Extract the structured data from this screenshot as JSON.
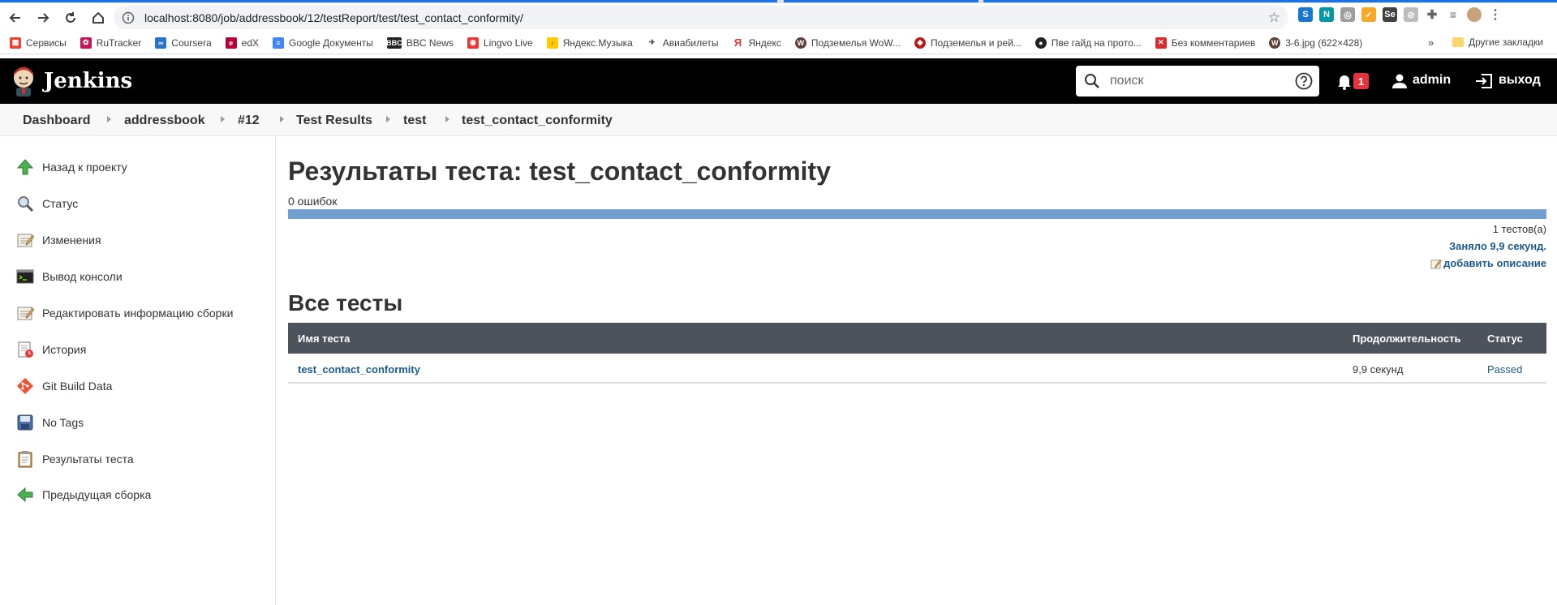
{
  "browser": {
    "url": "localhost:8080/job/addressbook/12/testReport/test/test_contact_conformity/",
    "bookmarks": [
      {
        "label": "Сервисы",
        "color": "#4285f4"
      },
      {
        "label": "RuTracker",
        "color": "#c2185b"
      },
      {
        "label": "Coursera",
        "color": "#2a73cc"
      },
      {
        "label": "edX",
        "color": "#b3003b"
      },
      {
        "label": "Google Документы",
        "color": "#4285f4"
      },
      {
        "label": "BBC News",
        "color": "#222222"
      },
      {
        "label": "Lingvo Live",
        "color": "#e53935"
      },
      {
        "label": "Яндекс.Музыка",
        "color": "#ffcc00"
      },
      {
        "label": "Авиабилеты",
        "color": "#333333"
      },
      {
        "label": "Яндекс",
        "color": "#e53935"
      },
      {
        "label": "Подземелья WoW...",
        "color": "#5d4037"
      },
      {
        "label": "Подземелья и рей...",
        "color": "#b71c1c"
      },
      {
        "label": "Пве гайд на прото...",
        "color": "#212121"
      },
      {
        "label": "Без комментариев",
        "color": "#d32f2f"
      },
      {
        "label": "3-6.jpg (622×428)",
        "color": "#5d4037"
      }
    ],
    "bookmarks_more": "»",
    "bookmarks_other": "Другие закладки"
  },
  "header": {
    "brand": "Jenkins",
    "search_placeholder": "поиск",
    "notifications_count": "1",
    "user": "admin",
    "logout": "выход"
  },
  "breadcrumb": [
    "Dashboard",
    "addressbook",
    "#12",
    "Test Results",
    "test",
    "test_contact_conformity"
  ],
  "sidebar": [
    {
      "label": "Назад к проекту",
      "icon": "up-arrow-icon"
    },
    {
      "label": "Статус",
      "icon": "magnifier-icon"
    },
    {
      "label": "Изменения",
      "icon": "notepad-icon"
    },
    {
      "label": "Вывод консоли",
      "icon": "terminal-icon"
    },
    {
      "label": "Редактировать информацию сборки",
      "icon": "notepad-edit-icon"
    },
    {
      "label": "История",
      "icon": "history-icon"
    },
    {
      "label": "Git Build Data",
      "icon": "git-icon"
    },
    {
      "label": "No Tags",
      "icon": "save-icon"
    },
    {
      "label": "Результаты теста",
      "icon": "clipboard-icon"
    },
    {
      "label": "Предыдущая сборка",
      "icon": "left-arrow-icon"
    }
  ],
  "main": {
    "title": "Результаты теста: test_contact_conformity",
    "fail_count": "0 ошибок",
    "pass_fraction": 1.0,
    "tests_count": "1 тестов(а)",
    "took": "Заняло 9,9 секунд.",
    "add_description": "добавить описание",
    "section_title": "Все тесты",
    "table": {
      "headers": [
        "Имя теста",
        "Продолжительность",
        "Статус"
      ],
      "rows": [
        {
          "name": "test_contact_conformity",
          "duration": "9,9 секунд",
          "status": "Passed"
        }
      ]
    }
  }
}
